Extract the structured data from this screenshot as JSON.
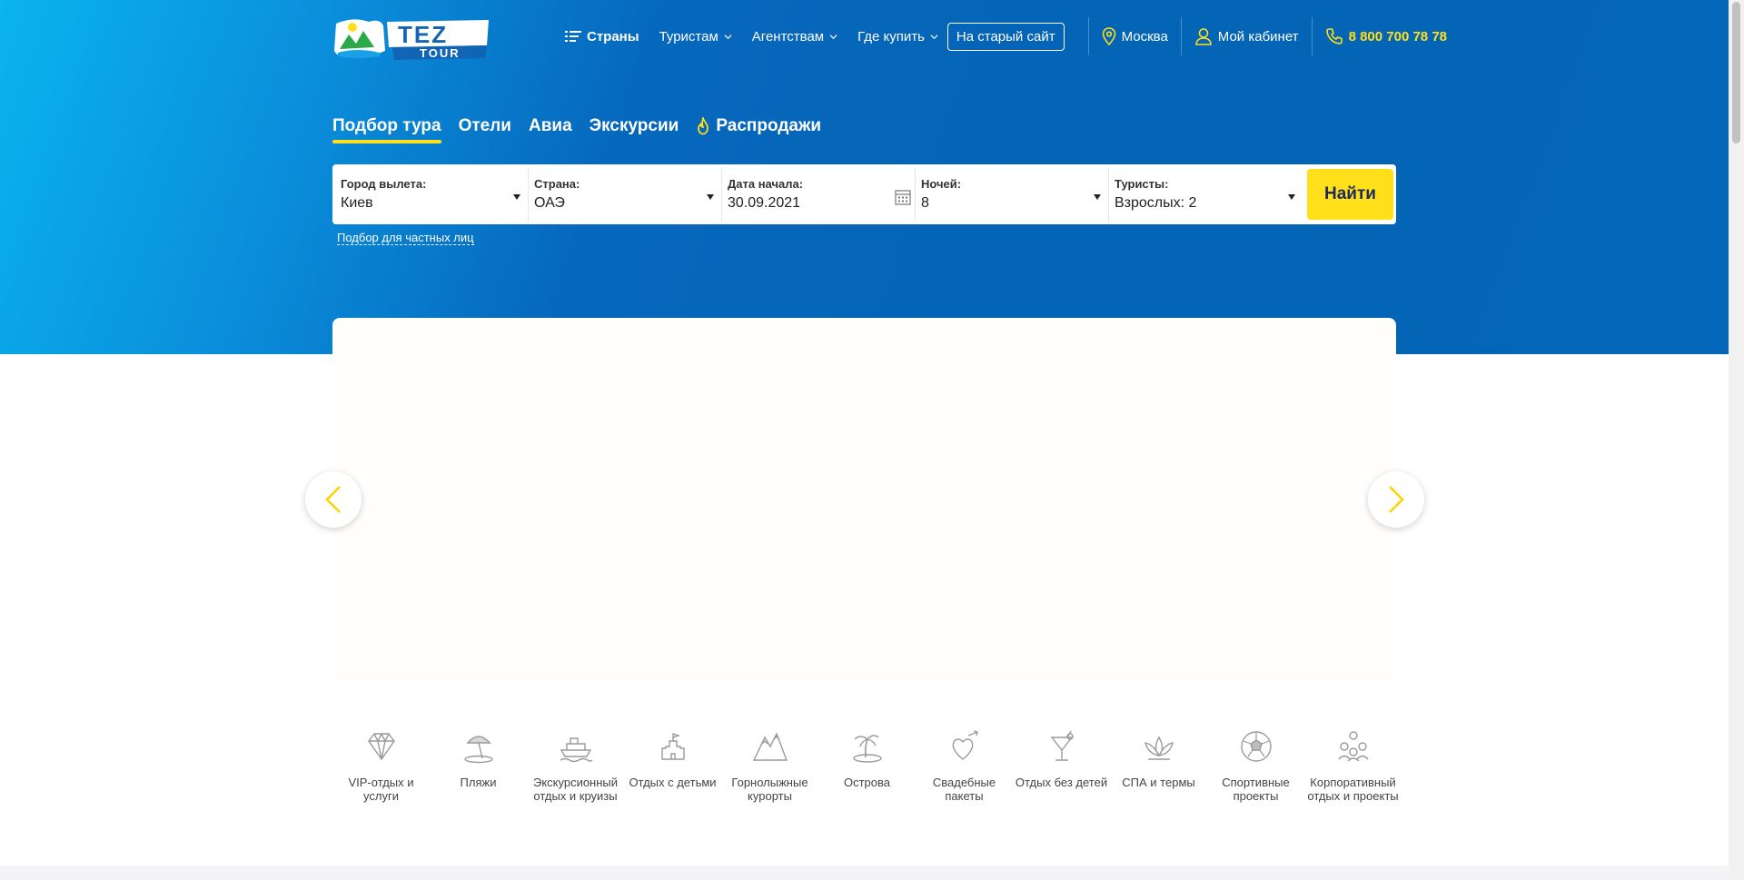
{
  "header": {
    "nav": [
      {
        "label": "Страны",
        "has_dropdown": false,
        "icon": "list-icon",
        "bold": true
      },
      {
        "label": "Туристам",
        "has_dropdown": true
      },
      {
        "label": "Агентствам",
        "has_dropdown": true
      },
      {
        "label": "Где купить",
        "has_dropdown": true
      }
    ],
    "old_site_label": "На старый сайт",
    "city": "Москва",
    "cabinet": "Мой кабинет",
    "phone": "8 800 700 78 78"
  },
  "tabs": [
    {
      "label": "Подбор тура",
      "active": true
    },
    {
      "label": "Отели"
    },
    {
      "label": "Авиа"
    },
    {
      "label": "Экскурсии"
    },
    {
      "label": "Распродажи",
      "icon": "flame-icon"
    }
  ],
  "search": {
    "departure": {
      "label": "Город вылета:",
      "value": "Киев"
    },
    "country": {
      "label": "Страна:",
      "value": "ОАЭ"
    },
    "date": {
      "label": "Дата начала:",
      "value": "30.09.2021"
    },
    "nights": {
      "label": "Ночей:",
      "value": "8"
    },
    "tourists": {
      "label": "Туристы:",
      "value": "Взрослых: 2"
    },
    "submit": "Найти",
    "private_link": "Подбор для частных лиц"
  },
  "categories": [
    {
      "label": "VIP-отдых и услуги",
      "icon": "diamond-icon"
    },
    {
      "label": "Пляжи",
      "icon": "beach-umbrella-icon"
    },
    {
      "label": "Экскурсионный отдых и круизы",
      "icon": "cruise-ship-icon"
    },
    {
      "label": "Отдых с детьми",
      "icon": "sandcastle-icon"
    },
    {
      "label": "Горнолыжные курорты",
      "icon": "mountains-icon"
    },
    {
      "label": "Острова",
      "icon": "island-palm-icon"
    },
    {
      "label": "Свадебные пакеты",
      "icon": "wedding-heart-icon"
    },
    {
      "label": "Отдых без детей",
      "icon": "cocktail-icon"
    },
    {
      "label": "СПА и термы",
      "icon": "lotus-icon"
    },
    {
      "label": "Спортивные проекты",
      "icon": "soccer-ball-icon"
    },
    {
      "label": "Корпоративный отдых и проекты",
      "icon": "team-icon"
    }
  ],
  "colors": {
    "accent_yellow": "#ffe01a",
    "hero_blue": "#0466b8",
    "hero_light_blue": "#0ab4ee",
    "button_text": "#1d2b5a"
  }
}
